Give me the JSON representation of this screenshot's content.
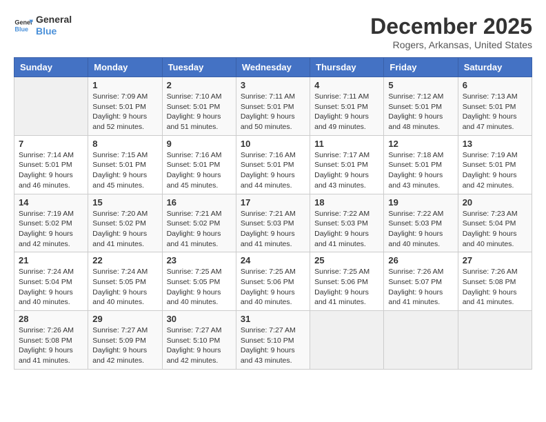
{
  "header": {
    "logo_line1": "General",
    "logo_line2": "Blue",
    "month_title": "December 2025",
    "location": "Rogers, Arkansas, United States"
  },
  "weekdays": [
    "Sunday",
    "Monday",
    "Tuesday",
    "Wednesday",
    "Thursday",
    "Friday",
    "Saturday"
  ],
  "weeks": [
    [
      {
        "day": "",
        "sunrise": "",
        "sunset": "",
        "daylight": ""
      },
      {
        "day": "1",
        "sunrise": "Sunrise: 7:09 AM",
        "sunset": "Sunset: 5:01 PM",
        "daylight": "Daylight: 9 hours and 52 minutes."
      },
      {
        "day": "2",
        "sunrise": "Sunrise: 7:10 AM",
        "sunset": "Sunset: 5:01 PM",
        "daylight": "Daylight: 9 hours and 51 minutes."
      },
      {
        "day": "3",
        "sunrise": "Sunrise: 7:11 AM",
        "sunset": "Sunset: 5:01 PM",
        "daylight": "Daylight: 9 hours and 50 minutes."
      },
      {
        "day": "4",
        "sunrise": "Sunrise: 7:11 AM",
        "sunset": "Sunset: 5:01 PM",
        "daylight": "Daylight: 9 hours and 49 minutes."
      },
      {
        "day": "5",
        "sunrise": "Sunrise: 7:12 AM",
        "sunset": "Sunset: 5:01 PM",
        "daylight": "Daylight: 9 hours and 48 minutes."
      },
      {
        "day": "6",
        "sunrise": "Sunrise: 7:13 AM",
        "sunset": "Sunset: 5:01 PM",
        "daylight": "Daylight: 9 hours and 47 minutes."
      }
    ],
    [
      {
        "day": "7",
        "sunrise": "Sunrise: 7:14 AM",
        "sunset": "Sunset: 5:01 PM",
        "daylight": "Daylight: 9 hours and 46 minutes."
      },
      {
        "day": "8",
        "sunrise": "Sunrise: 7:15 AM",
        "sunset": "Sunset: 5:01 PM",
        "daylight": "Daylight: 9 hours and 45 minutes."
      },
      {
        "day": "9",
        "sunrise": "Sunrise: 7:16 AM",
        "sunset": "Sunset: 5:01 PM",
        "daylight": "Daylight: 9 hours and 45 minutes."
      },
      {
        "day": "10",
        "sunrise": "Sunrise: 7:16 AM",
        "sunset": "Sunset: 5:01 PM",
        "daylight": "Daylight: 9 hours and 44 minutes."
      },
      {
        "day": "11",
        "sunrise": "Sunrise: 7:17 AM",
        "sunset": "Sunset: 5:01 PM",
        "daylight": "Daylight: 9 hours and 43 minutes."
      },
      {
        "day": "12",
        "sunrise": "Sunrise: 7:18 AM",
        "sunset": "Sunset: 5:01 PM",
        "daylight": "Daylight: 9 hours and 43 minutes."
      },
      {
        "day": "13",
        "sunrise": "Sunrise: 7:19 AM",
        "sunset": "Sunset: 5:01 PM",
        "daylight": "Daylight: 9 hours and 42 minutes."
      }
    ],
    [
      {
        "day": "14",
        "sunrise": "Sunrise: 7:19 AM",
        "sunset": "Sunset: 5:02 PM",
        "daylight": "Daylight: 9 hours and 42 minutes."
      },
      {
        "day": "15",
        "sunrise": "Sunrise: 7:20 AM",
        "sunset": "Sunset: 5:02 PM",
        "daylight": "Daylight: 9 hours and 41 minutes."
      },
      {
        "day": "16",
        "sunrise": "Sunrise: 7:21 AM",
        "sunset": "Sunset: 5:02 PM",
        "daylight": "Daylight: 9 hours and 41 minutes."
      },
      {
        "day": "17",
        "sunrise": "Sunrise: 7:21 AM",
        "sunset": "Sunset: 5:03 PM",
        "daylight": "Daylight: 9 hours and 41 minutes."
      },
      {
        "day": "18",
        "sunrise": "Sunrise: 7:22 AM",
        "sunset": "Sunset: 5:03 PM",
        "daylight": "Daylight: 9 hours and 41 minutes."
      },
      {
        "day": "19",
        "sunrise": "Sunrise: 7:22 AM",
        "sunset": "Sunset: 5:03 PM",
        "daylight": "Daylight: 9 hours and 40 minutes."
      },
      {
        "day": "20",
        "sunrise": "Sunrise: 7:23 AM",
        "sunset": "Sunset: 5:04 PM",
        "daylight": "Daylight: 9 hours and 40 minutes."
      }
    ],
    [
      {
        "day": "21",
        "sunrise": "Sunrise: 7:24 AM",
        "sunset": "Sunset: 5:04 PM",
        "daylight": "Daylight: 9 hours and 40 minutes."
      },
      {
        "day": "22",
        "sunrise": "Sunrise: 7:24 AM",
        "sunset": "Sunset: 5:05 PM",
        "daylight": "Daylight: 9 hours and 40 minutes."
      },
      {
        "day": "23",
        "sunrise": "Sunrise: 7:25 AM",
        "sunset": "Sunset: 5:05 PM",
        "daylight": "Daylight: 9 hours and 40 minutes."
      },
      {
        "day": "24",
        "sunrise": "Sunrise: 7:25 AM",
        "sunset": "Sunset: 5:06 PM",
        "daylight": "Daylight: 9 hours and 40 minutes."
      },
      {
        "day": "25",
        "sunrise": "Sunrise: 7:25 AM",
        "sunset": "Sunset: 5:06 PM",
        "daylight": "Daylight: 9 hours and 41 minutes."
      },
      {
        "day": "26",
        "sunrise": "Sunrise: 7:26 AM",
        "sunset": "Sunset: 5:07 PM",
        "daylight": "Daylight: 9 hours and 41 minutes."
      },
      {
        "day": "27",
        "sunrise": "Sunrise: 7:26 AM",
        "sunset": "Sunset: 5:08 PM",
        "daylight": "Daylight: 9 hours and 41 minutes."
      }
    ],
    [
      {
        "day": "28",
        "sunrise": "Sunrise: 7:26 AM",
        "sunset": "Sunset: 5:08 PM",
        "daylight": "Daylight: 9 hours and 41 minutes."
      },
      {
        "day": "29",
        "sunrise": "Sunrise: 7:27 AM",
        "sunset": "Sunset: 5:09 PM",
        "daylight": "Daylight: 9 hours and 42 minutes."
      },
      {
        "day": "30",
        "sunrise": "Sunrise: 7:27 AM",
        "sunset": "Sunset: 5:10 PM",
        "daylight": "Daylight: 9 hours and 42 minutes."
      },
      {
        "day": "31",
        "sunrise": "Sunrise: 7:27 AM",
        "sunset": "Sunset: 5:10 PM",
        "daylight": "Daylight: 9 hours and 43 minutes."
      },
      {
        "day": "",
        "sunrise": "",
        "sunset": "",
        "daylight": ""
      },
      {
        "day": "",
        "sunrise": "",
        "sunset": "",
        "daylight": ""
      },
      {
        "day": "",
        "sunrise": "",
        "sunset": "",
        "daylight": ""
      }
    ]
  ]
}
